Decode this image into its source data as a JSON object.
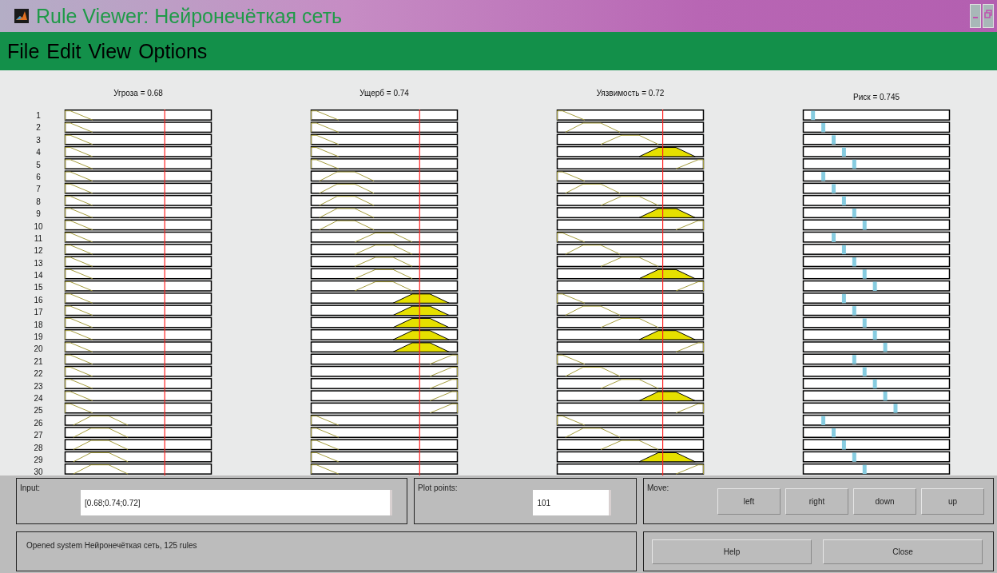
{
  "window": {
    "title": "Rule Viewer: Нейронечёткая сеть"
  },
  "menu": [
    "File",
    "Edit",
    "View",
    "Options"
  ],
  "variables": [
    {
      "kind": "input",
      "title": "Угроза = 0.68",
      "level": 0.68
    },
    {
      "kind": "input",
      "title": "Ущерб = 0.74",
      "level": 0.74
    },
    {
      "kind": "input",
      "title": "Уязвимость = 0.72",
      "level": 0.72
    },
    {
      "kind": "output",
      "title": "Риск = 0.745"
    }
  ],
  "rules": [
    "1",
    "2",
    "3",
    "4",
    "5",
    "6",
    "7",
    "8",
    "9",
    "10",
    "11",
    "12",
    "13",
    "14",
    "15",
    "16",
    "17",
    "18",
    "19",
    "20",
    "21",
    "22",
    "23",
    "24",
    "25",
    "26",
    "27",
    "28",
    "29",
    "30"
  ],
  "input_panel": {
    "label": "Input:",
    "value": "[0.68;0.74;0.72]"
  },
  "plot_points": {
    "label": "Plot points:",
    "value": "101"
  },
  "move": {
    "label": "Move:",
    "buttons": [
      "left",
      "right",
      "down",
      "up"
    ]
  },
  "status": "Opened system Нейронечёткая сеть, 125 rules",
  "buttons": [
    "Help",
    "Close"
  ]
}
